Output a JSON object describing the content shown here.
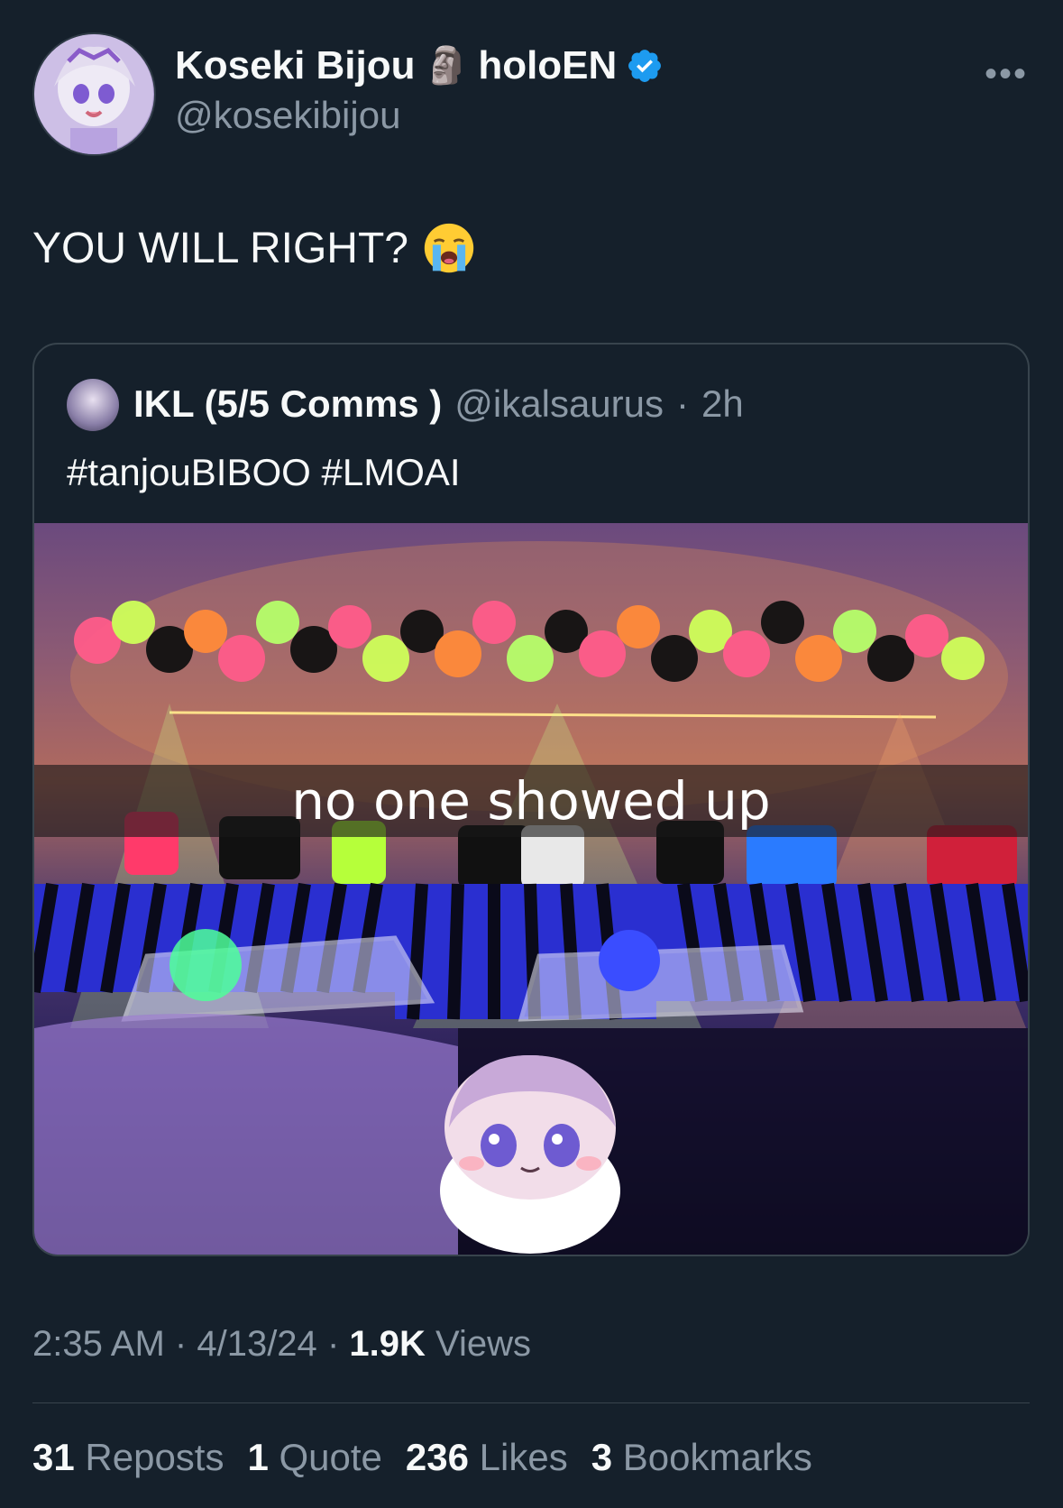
{
  "author": {
    "display_name": "Koseki Bijou",
    "name_emoji": "🗿",
    "affiliation": "holoEN",
    "handle": "@kosekibijou",
    "verified_icon": "verified-badge-icon",
    "more_label": "•••"
  },
  "tweet": {
    "text": "YOU WILL RIGHT?",
    "emoji": "loudly-crying-face"
  },
  "quoted": {
    "display_name": "IKL (5/5 Comms )",
    "handle": "@ikalsaurus",
    "separator": "·",
    "time": "2h",
    "text": "#tanjouBIBOO #LMOAI",
    "image_caption": "no one showed up"
  },
  "meta": {
    "time": "2:35 AM",
    "date": "4/13/24",
    "separator": "·",
    "views_count": "1.9K",
    "views_label": "Views"
  },
  "stats": {
    "reposts_count": "31",
    "reposts_label": "Reposts",
    "quotes_count": "1",
    "quotes_label": "Quote",
    "likes_count": "236",
    "likes_label": "Likes",
    "bookmarks_count": "3",
    "bookmarks_label": "Bookmarks"
  },
  "colors": {
    "background": "#15202b",
    "primary_text": "#f7f9f9",
    "secondary_text": "#8b98a5",
    "border": "#38444d",
    "verified_blue": "#1d9bf0"
  }
}
